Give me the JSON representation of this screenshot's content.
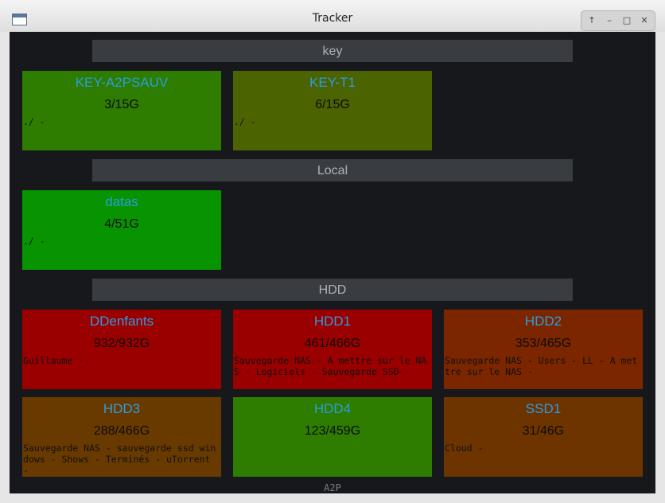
{
  "window": {
    "title": "Tracker",
    "controls": [
      "↑",
      "–",
      "□",
      "✕"
    ]
  },
  "sections": [
    {
      "label": "key"
    },
    {
      "label": "Local"
    },
    {
      "label": "HDD"
    }
  ],
  "drives": [
    {
      "name": "KEY-A2PSAUV",
      "usage": "3/15G",
      "desc": "./ -",
      "color": "#2e7c00"
    },
    {
      "name": "KEY-T1",
      "usage": "6/15G",
      "desc": "./ -",
      "color": "#4b6300"
    },
    {
      "name": "datas",
      "usage": "4/51G",
      "desc": "./ -",
      "color": "#079400"
    },
    {
      "name": "DDenfants",
      "usage": "932/932G",
      "desc": "Guillaume -",
      "color": "#9b0000"
    },
    {
      "name": "HDD1",
      "usage": "461/466G",
      "desc": "Sauvegarde NAS - A mettre sur le NAS - Logiciels - Sauvegarde SSD -",
      "color": "#9b0000"
    },
    {
      "name": "HDD2",
      "usage": "353/465G",
      "desc": "Sauvegarde NAS - Users - LL - A mettre sur le NAS -",
      "color": "#7c2600"
    },
    {
      "name": "HDD3",
      "usage": "288/466G",
      "desc": "Sauvegarde NAS - sauvegarde ssd windows - Shows - Terminés - uTorrent -",
      "color": "#693a00"
    },
    {
      "name": "HDD4",
      "usage": "123/459G",
      "desc": "",
      "color": "#2e7c00"
    },
    {
      "name": "SSD1",
      "usage": "31/46G",
      "desc": "Cloud -",
      "color": "#6d3400"
    }
  ],
  "footer": "A2P"
}
